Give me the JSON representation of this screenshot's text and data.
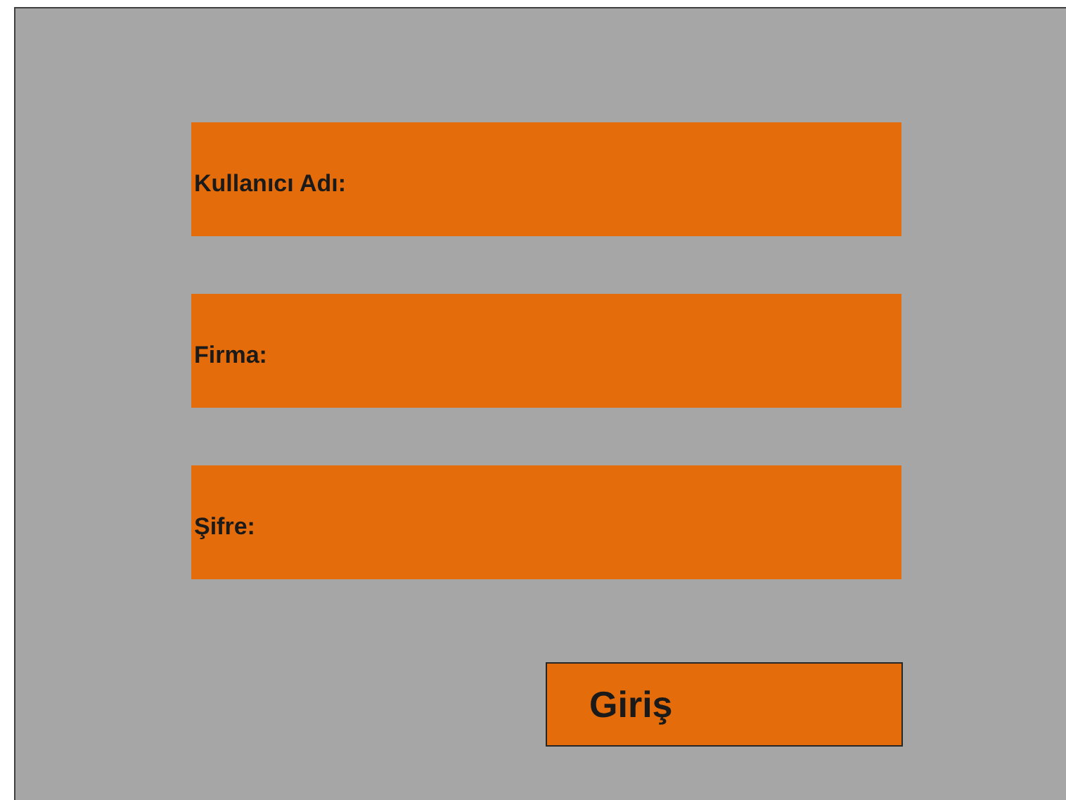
{
  "fields": [
    {
      "label": "Kullanıcı Adı:"
    },
    {
      "label": "Firma:"
    },
    {
      "label": "Şifre:"
    }
  ],
  "button": {
    "label": "Giriş"
  }
}
